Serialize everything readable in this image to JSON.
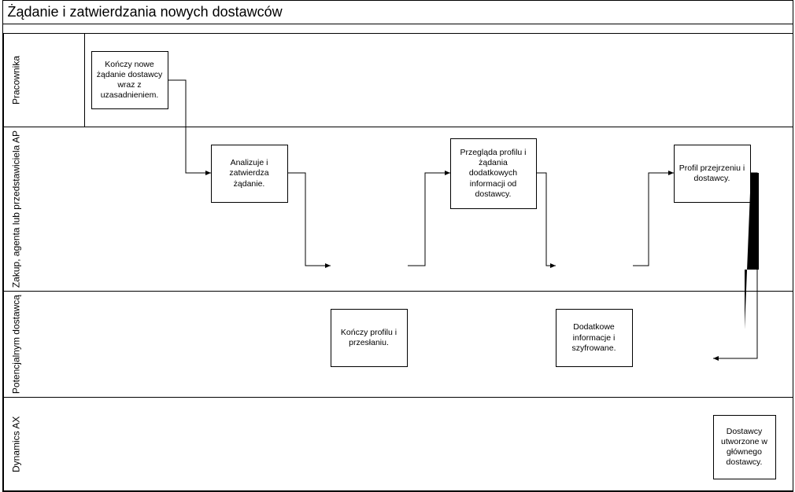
{
  "title": "Żądanie i zatwierdzania nowych dostawców",
  "lanes": {
    "l1": "Pracownika",
    "l2": "Zakup, agenta lub przedstawiciela AP",
    "l3": "Potencjalnym dostawcą",
    "l4": "Dynamics AX"
  },
  "activities": {
    "a1": "Kończy nowe żądanie dostawcy wraz z uzasadnieniem.",
    "a2": "Analizuje i zatwierdza żądanie.",
    "a3": "Kończy profilu i przesłaniu.",
    "a4": "Przegląda profilu i żądania dodatkowych informacji od dostawcy.",
    "a5": "Dodatkowe informacje i szyfrowane.",
    "a6": "Profil przejrzeniu i dostawcy.",
    "a7": "Dostawcy utworzone w głównego dostawcy."
  }
}
